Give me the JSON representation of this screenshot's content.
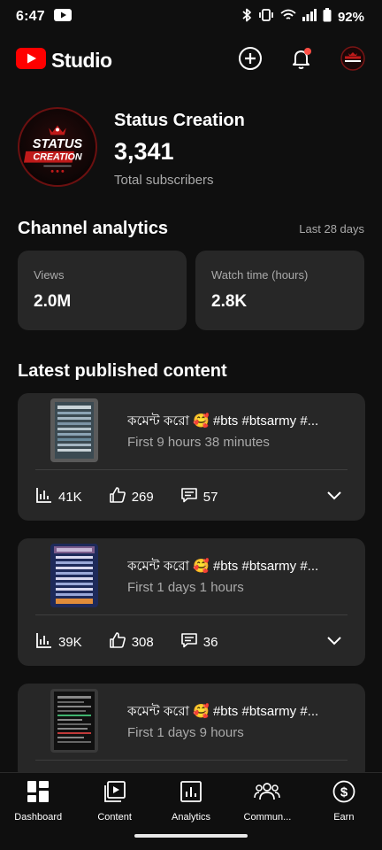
{
  "status_bar": {
    "time": "6:47",
    "battery": "92%",
    "icons": [
      "youtube-notification-icon",
      "bluetooth-icon",
      "vibrate-icon",
      "wifi-icon",
      "signal-icon",
      "battery-icon"
    ]
  },
  "header": {
    "app_name": "Studio",
    "brand_color": "#ff0000",
    "icons": [
      "create-icon",
      "notifications-icon",
      "account-avatar"
    ]
  },
  "channel": {
    "name": "Status Creation",
    "subscriber_count": "3,341",
    "subscriber_label": "Total subscribers",
    "avatar_text_1": "STATUS",
    "avatar_text_2": "CREATION"
  },
  "analytics": {
    "title": "Channel analytics",
    "period": "Last 28 days",
    "cards": [
      {
        "label": "Views",
        "value": "2.0M"
      },
      {
        "label": "Watch time (hours)",
        "value": "2.8K"
      }
    ]
  },
  "latest": {
    "title": "Latest published content",
    "items": [
      {
        "title": "কমেন্ট করো 🥰 #bts #btsarmy #...",
        "subtitle": "First 9 hours 38 minutes",
        "views": "41K",
        "likes": "269",
        "comments": "57"
      },
      {
        "title": "কমেন্ট করো 🥰 #bts #btsarmy #...",
        "subtitle": "First 1 days 1 hours",
        "views": "39K",
        "likes": "308",
        "comments": "36"
      },
      {
        "title": "কমেন্ট করো 🥰 #bts #btsarmy #...",
        "subtitle": "First 1 days 9 hours",
        "views": "",
        "likes": "",
        "comments": ""
      }
    ]
  },
  "bottom_nav": {
    "items": [
      {
        "label": "Dashboard",
        "icon": "dashboard-icon",
        "active": true
      },
      {
        "label": "Content",
        "icon": "content-icon",
        "active": false
      },
      {
        "label": "Analytics",
        "icon": "analytics-icon",
        "active": false
      },
      {
        "label": "Commun...",
        "icon": "community-icon",
        "active": false
      },
      {
        "label": "Earn",
        "icon": "earn-icon",
        "active": false
      }
    ]
  }
}
